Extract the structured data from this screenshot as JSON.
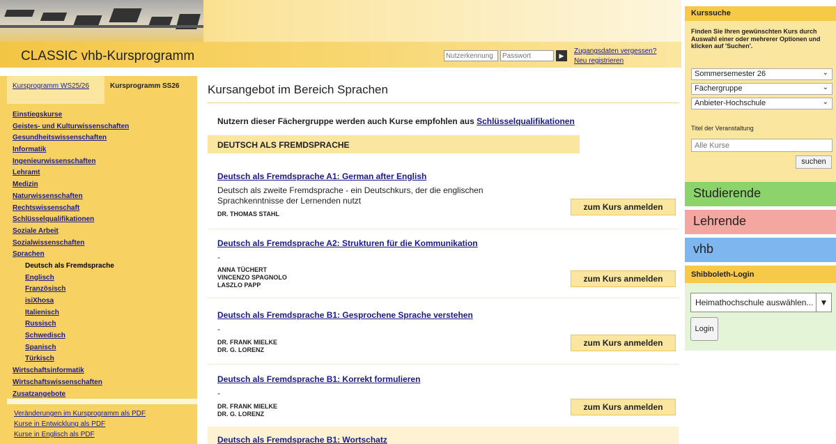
{
  "header": {
    "site_title": "CLASSIC vhb-Kursprogramm",
    "username_placeholder": "Nutzerkennung",
    "password_placeholder": "Passwort",
    "forgot_link": "Zugangsdaten vergessen?",
    "register_link": "Neu registrieren"
  },
  "left": {
    "tabs": [
      {
        "label": "Kursprogramm WS25/26"
      },
      {
        "label": "Kursprogramm SS26"
      }
    ],
    "nav": [
      {
        "label": "Einstiegskurse"
      },
      {
        "label": "Geistes- und Kulturwissenschaften"
      },
      {
        "label": "Gesundheitswissenschaften"
      },
      {
        "label": "Informatik"
      },
      {
        "label": "Ingenieurwissenschaften"
      },
      {
        "label": "Lehramt"
      },
      {
        "label": "Medizin"
      },
      {
        "label": "Naturwissenschaften"
      },
      {
        "label": "Rechtswissenschaft"
      },
      {
        "label": "Schlüsselqualifikationen"
      },
      {
        "label": "Soziale Arbeit"
      },
      {
        "label": "Sozialwissenschaften"
      },
      {
        "label": "Sprachen"
      },
      {
        "label": "Deutsch als Fremdsprache"
      },
      {
        "label": "Englisch"
      },
      {
        "label": "Französisch"
      },
      {
        "label": "isiXhosa"
      },
      {
        "label": "Italienisch"
      },
      {
        "label": "Russisch"
      },
      {
        "label": "Schwedisch"
      },
      {
        "label": "Spanisch"
      },
      {
        "label": "Türkisch"
      },
      {
        "label": "Wirtschaftsinformatik"
      },
      {
        "label": "Wirtschaftswissenschaften"
      },
      {
        "label": "Zusatzangebote"
      }
    ],
    "pdf_links": [
      {
        "label": "Veränderungen im Kursprogramm als PDF"
      },
      {
        "label": "Kurse in Entwicklung als PDF"
      },
      {
        "label": "Kurse in Englisch als PDF"
      }
    ]
  },
  "main": {
    "title": "Kursangebot im Bereich Sprachen",
    "recommend_text": "Nutzern dieser Fächergruppe werden auch Kurse empfohlen aus ",
    "recommend_link": "Schlüsselqualifikationen",
    "section_heading": "DEUTSCH ALS FREMDSPRACHE",
    "enroll_label": "zum Kurs anmelden",
    "courses": [
      {
        "title": "Deutsch als Fremdsprache A1: German after English",
        "description": "Deutsch als zweite Fremdsprache - ein Deutschkurs, der die englischen Sprachkenntnisse der Lernenden nutzt",
        "teachers": [
          "DR. THOMAS STAHL"
        ]
      },
      {
        "title": "Deutsch als Fremdsprache A2: Strukturen für die Kommunikation",
        "description": "-",
        "teachers": [
          "ANNA TÜCHERT",
          "VINCENZO SPAGNOLO",
          "LASZLO PAPP"
        ]
      },
      {
        "title": "Deutsch als Fremdsprache B1: Gesprochene Sprache verstehen",
        "description": "-",
        "teachers": [
          "DR. FRANK MIELKE",
          "DR. G. LORENZ"
        ]
      },
      {
        "title": "Deutsch als Fremdsprache B1: Korrekt formulieren",
        "description": "-",
        "teachers": [
          "DR. FRANK MIELKE",
          "DR. G. LORENZ"
        ]
      }
    ],
    "last_course_title": "Deutsch als Fremdsprache B1: Wortschatz"
  },
  "right": {
    "kurssuche_heading": "Kurssuche",
    "kurssuche_text": "Finden Sie Ihren gewünschten Kurs durch Auswahl einer oder mehrerer Optionen und klicken auf 'Suchen'.",
    "semester_select": "Sommersemester 26",
    "faecher_select": "Fächergruppe",
    "anbieter_select": "Anbieter-Hochschule",
    "title_label": "Titel der Veranstaltung",
    "title_placeholder": "Alle Kurse",
    "search_button": "suchen",
    "studierende": "Studierende",
    "lehrende": "Lehrende",
    "vhb": "vhb",
    "shib_heading": "Shibboleth-Login",
    "shib_select": "Heimathochschule auswählen...",
    "login_button": "Login"
  },
  "colors": {
    "accent_yellow": "#f7c948",
    "studierende": "#8bd36a",
    "lehrende": "#f4a6a0",
    "vhb": "#7eb7f0"
  }
}
